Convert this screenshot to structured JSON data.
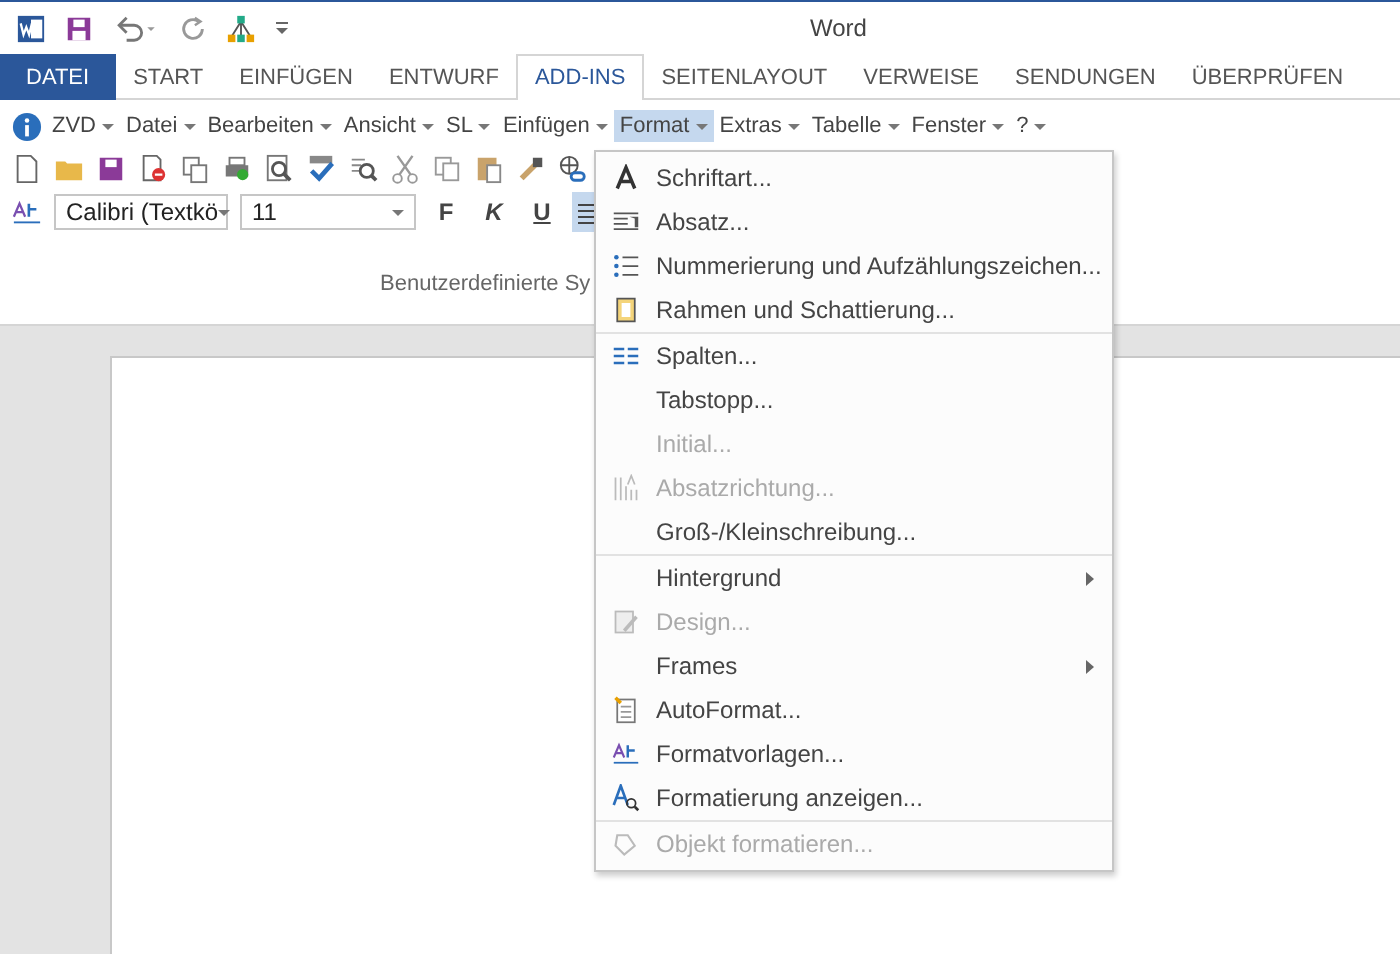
{
  "window": {
    "title": "Word"
  },
  "tabs": [
    {
      "label": "DATEI",
      "kind": "file",
      "selected": false
    },
    {
      "label": "START",
      "kind": "tab",
      "selected": false
    },
    {
      "label": "EINFÜGEN",
      "kind": "tab",
      "selected": false
    },
    {
      "label": "ENTWURF",
      "kind": "tab",
      "selected": false
    },
    {
      "label": "ADD-INS",
      "kind": "tab",
      "selected": true
    },
    {
      "label": "SEITENLAYOUT",
      "kind": "tab",
      "selected": false
    },
    {
      "label": "VERWEISE",
      "kind": "tab",
      "selected": false
    },
    {
      "label": "SENDUNGEN",
      "kind": "tab",
      "selected": false
    },
    {
      "label": "ÜBERPRÜFEN",
      "kind": "tab",
      "selected": false
    }
  ],
  "menubar": [
    {
      "label": "ZVD",
      "selected": false
    },
    {
      "label": "Datei",
      "selected": false
    },
    {
      "label": "Bearbeiten",
      "selected": false
    },
    {
      "label": "Ansicht",
      "selected": false
    },
    {
      "label": "SL",
      "selected": false
    },
    {
      "label": "Einfügen",
      "selected": false
    },
    {
      "label": "Format",
      "selected": true
    },
    {
      "label": "Extras",
      "selected": false
    },
    {
      "label": "Tabelle",
      "selected": false
    },
    {
      "label": "Fenster",
      "selected": false
    },
    {
      "label": "?",
      "selected": false
    }
  ],
  "formatting": {
    "font": "Calibri (Textkö",
    "size": "11",
    "buttons": [
      {
        "label": "F",
        "kind": "bold",
        "selected": false
      },
      {
        "label": "K",
        "kind": "italic",
        "selected": false
      },
      {
        "label": "U",
        "kind": "underline",
        "selected": false
      }
    ],
    "align_left_selected": true
  },
  "group_label": "Benutzerdefinierte Sy",
  "format_menu": [
    {
      "label": "Schriftart...",
      "kind": "font",
      "disabled": false,
      "submenu": false,
      "separator_after": false
    },
    {
      "label": "Absatz...",
      "kind": "paragraph",
      "disabled": false,
      "submenu": false,
      "separator_after": false
    },
    {
      "label": "Nummerierung und Aufzählungszeichen...",
      "kind": "list",
      "disabled": false,
      "submenu": false,
      "separator_after": false
    },
    {
      "label": "Rahmen und Schattierung...",
      "kind": "border",
      "disabled": false,
      "submenu": false,
      "separator_after": true
    },
    {
      "label": "Spalten...",
      "kind": "columns",
      "disabled": false,
      "submenu": false,
      "separator_after": false
    },
    {
      "label": "Tabstopp...",
      "kind": "plain",
      "disabled": false,
      "submenu": false,
      "separator_after": false
    },
    {
      "label": "Initial...",
      "kind": "plain",
      "disabled": true,
      "submenu": false,
      "separator_after": false
    },
    {
      "label": "Absatzrichtung...",
      "kind": "direction",
      "disabled": true,
      "submenu": false,
      "separator_after": false
    },
    {
      "label": "Groß-/Kleinschreibung...",
      "kind": "plain",
      "disabled": false,
      "submenu": false,
      "separator_after": true
    },
    {
      "label": "Hintergrund",
      "kind": "plain",
      "disabled": false,
      "submenu": true,
      "separator_after": false
    },
    {
      "label": "Design...",
      "kind": "design",
      "disabled": true,
      "submenu": false,
      "separator_after": false
    },
    {
      "label": "Frames",
      "kind": "plain",
      "disabled": false,
      "submenu": true,
      "separator_after": false
    },
    {
      "label": "AutoFormat...",
      "kind": "autoformat",
      "disabled": false,
      "submenu": false,
      "separator_after": false
    },
    {
      "label": "Formatvorlagen...",
      "kind": "styles",
      "disabled": false,
      "submenu": false,
      "separator_after": false
    },
    {
      "label": "Formatierung anzeigen...",
      "kind": "reveal",
      "disabled": false,
      "submenu": false,
      "separator_after": true
    },
    {
      "label": "Objekt formatieren...",
      "kind": "object",
      "disabled": true,
      "submenu": false,
      "separator_after": false
    }
  ]
}
